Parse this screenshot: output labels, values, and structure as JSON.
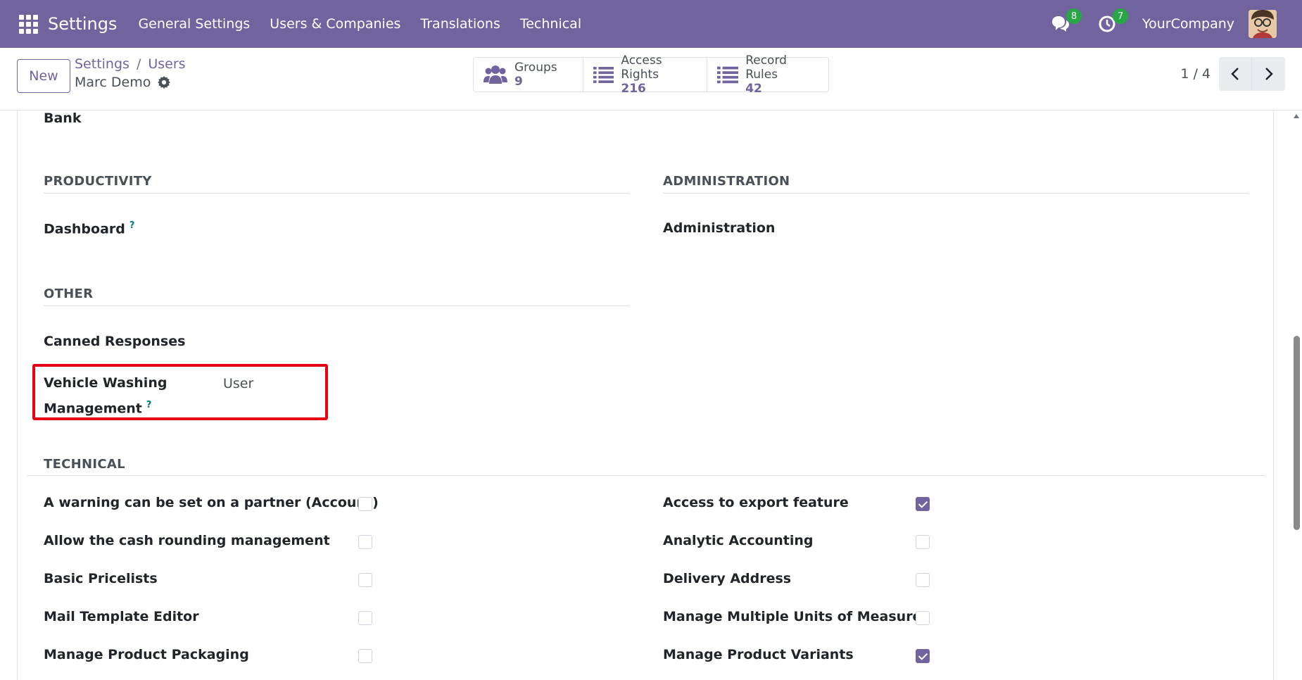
{
  "navbar": {
    "brand": "Settings",
    "menu": [
      "General Settings",
      "Users & Companies",
      "Translations",
      "Technical"
    ],
    "messages_count": "8",
    "activities_count": "7",
    "company": "YourCompany",
    "accent_color": "#71639e"
  },
  "control": {
    "new_label": "New",
    "breadcrumb": [
      "Settings",
      "Users"
    ],
    "breadcrumb_sep": "/",
    "record_name": "Marc Demo",
    "smart_buttons": [
      {
        "label": "Groups",
        "value": "9",
        "icon": "users-icon"
      },
      {
        "label": "Access Rights",
        "value": "216",
        "icon": "list-icon"
      },
      {
        "label": "Record Rules",
        "value": "42",
        "icon": "list-icon"
      }
    ],
    "pager": "1 / 4"
  },
  "form": {
    "bank_label": "Bank",
    "productivity": {
      "title": "PRODUCTIVITY",
      "dashboard_label": "Dashboard",
      "help": "?"
    },
    "administration": {
      "title": "ADMINISTRATION",
      "administration_label": "Administration"
    },
    "other": {
      "title": "OTHER",
      "canned_label": "Canned Responses",
      "vehicle_label_line1": "Vehicle Washing",
      "vehicle_label_line2": "Management",
      "vehicle_value": "User",
      "help": "?"
    },
    "technical": {
      "title": "TECHNICAL",
      "left": [
        {
          "label": "A warning can be set on a partner (Account)",
          "checked": false
        },
        {
          "label": "Allow the cash rounding management",
          "checked": false
        },
        {
          "label": "Basic Pricelists",
          "checked": false
        },
        {
          "label": "Mail Template Editor",
          "checked": false
        },
        {
          "label": "Manage Product Packaging",
          "checked": false
        }
      ],
      "right": [
        {
          "label": "Access to export feature",
          "checked": true
        },
        {
          "label": "Analytic Accounting",
          "checked": false
        },
        {
          "label": "Delivery Address",
          "checked": false
        },
        {
          "label": "Manage Multiple Units of Measure",
          "checked": false
        },
        {
          "label": "Manage Product Variants",
          "checked": true
        }
      ]
    },
    "highlight_color": "#e60012"
  }
}
